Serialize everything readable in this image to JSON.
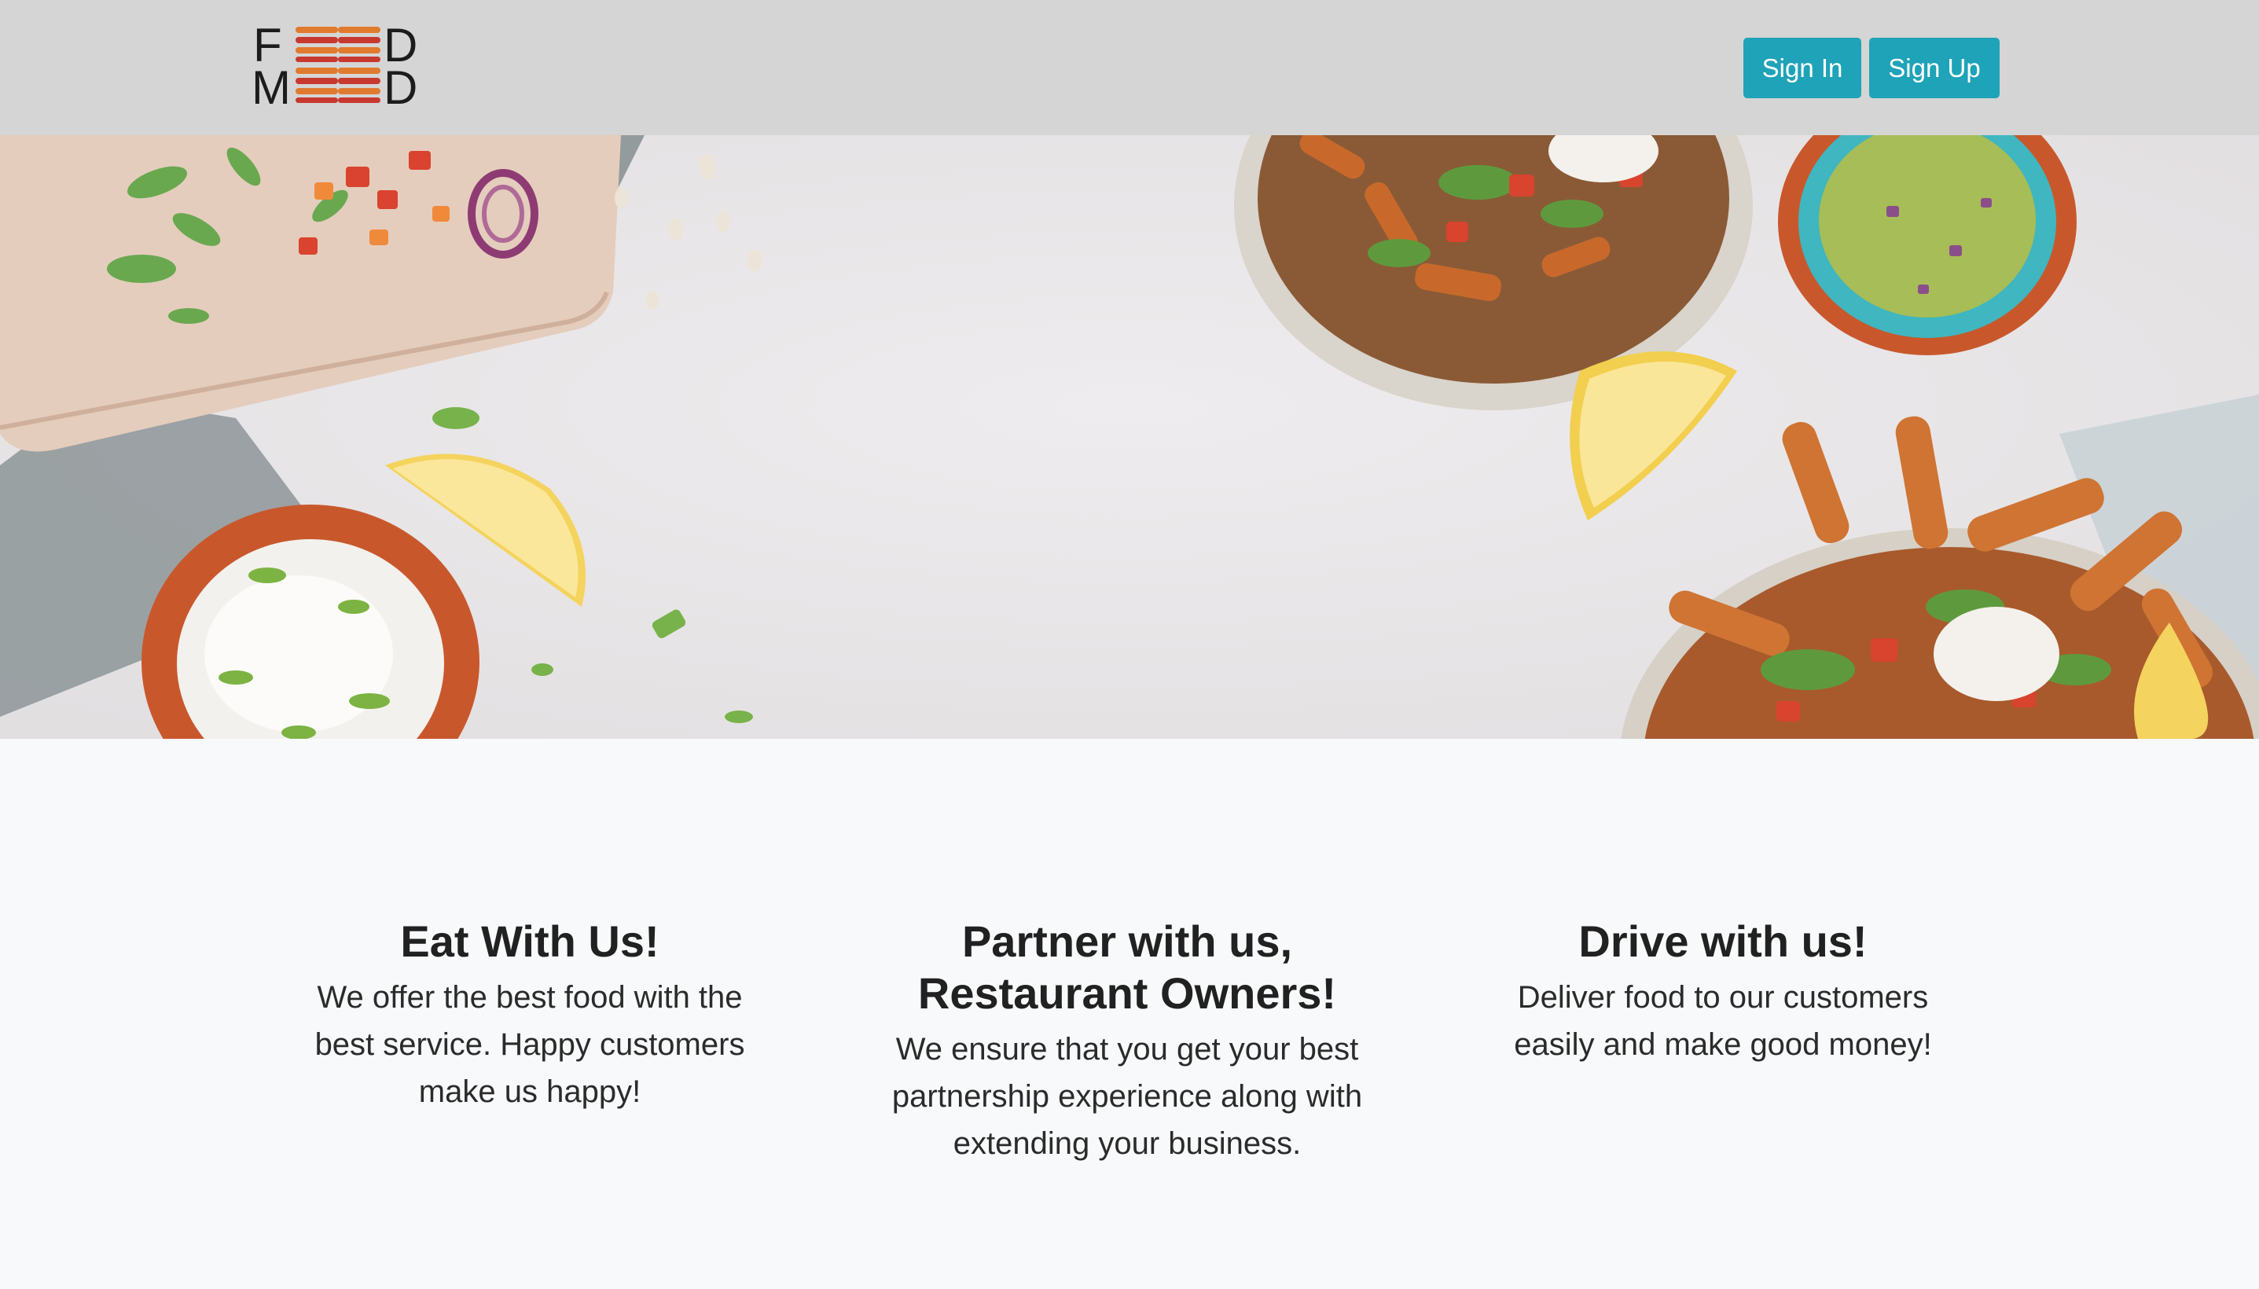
{
  "brand": {
    "logo_top": "F  D",
    "logo_bottom": "M  D",
    "letters": {
      "f": "F",
      "d": "D",
      "m": "M"
    },
    "burger_colors": [
      "#e07a2e",
      "#c7392f",
      "#e07a2e",
      "#c7392f"
    ]
  },
  "nav": {
    "sign_in_label": "Sign In",
    "sign_up_label": "Sign Up",
    "button_color": "#1fa3b8"
  },
  "hero": {
    "image": "food-bowls-banner"
  },
  "features": [
    {
      "title": "Eat With Us!",
      "text": "We offer the best food with the best service. Happy customers make us happy!"
    },
    {
      "title": "Partner with us, Restaurant Owners!",
      "text": "We ensure that you get your best partnership experience along with extending your business."
    },
    {
      "title": "Drive with us!",
      "text": "Deliver food to our customers easily and make good money!"
    }
  ]
}
